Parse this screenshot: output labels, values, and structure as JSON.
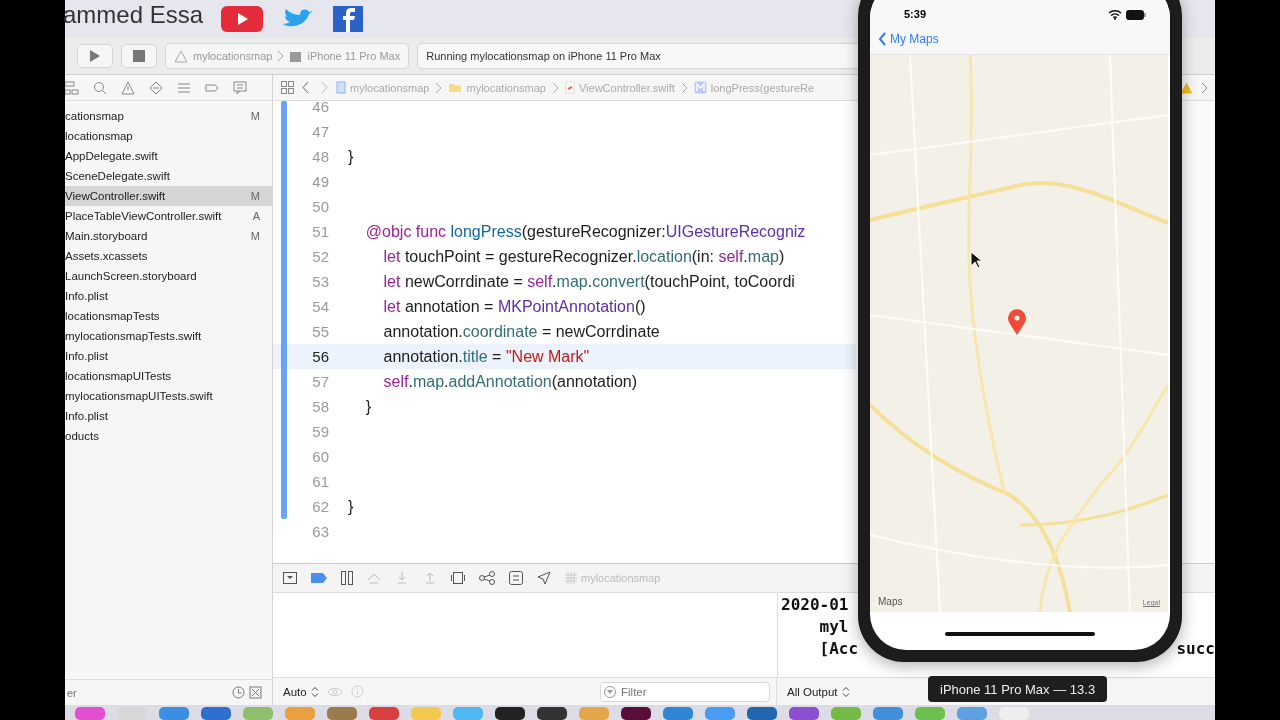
{
  "banner": {
    "name": "ammed Essa"
  },
  "toolbar": {
    "scheme": "mylocationsmap",
    "device": "iPhone 11 Pro Max",
    "status": "Running mylocationsmap on iPhone 11 Pro Max"
  },
  "navigator": {
    "items": [
      {
        "name": "cationsmap",
        "badge": "M",
        "selected": false
      },
      {
        "name": "locationsmap",
        "selected": false
      },
      {
        "name": "AppDelegate.swift",
        "selected": false
      },
      {
        "name": "SceneDelegate.swift",
        "selected": false
      },
      {
        "name": "ViewController.swift",
        "badge": "M",
        "selected": true
      },
      {
        "name": "PlaceTableViewController.swift",
        "badge": "A",
        "selected": false
      },
      {
        "name": "Main.storyboard",
        "badge": "M",
        "selected": false
      },
      {
        "name": "Assets.xcassets",
        "selected": false
      },
      {
        "name": "LaunchScreen.storyboard",
        "selected": false
      },
      {
        "name": "Info.plist",
        "selected": false
      },
      {
        "name": "locationsmapTests",
        "selected": false
      },
      {
        "name": "mylocationsmapTests.swift",
        "selected": false
      },
      {
        "name": "Info.plist",
        "selected": false
      },
      {
        "name": "locationsmapUITests",
        "selected": false
      },
      {
        "name": "mylocationsmapUITests.swift",
        "selected": false
      },
      {
        "name": "Info.plist",
        "selected": false
      },
      {
        "name": "oducts",
        "selected": false
      }
    ],
    "filter_placeholder": "er"
  },
  "jump_bar": {
    "path": [
      {
        "kind": "project",
        "label": "mylocationsmap"
      },
      {
        "kind": "folder",
        "label": "mylocationsmap"
      },
      {
        "kind": "swift",
        "label": "ViewController.swift"
      },
      {
        "kind": "method",
        "label": "longPress(gestureRe"
      }
    ]
  },
  "editor": {
    "lines": [
      {
        "number": "46",
        "current": false
      },
      {
        "number": "47",
        "current": false
      },
      {
        "number": "48",
        "current": false,
        "tokens": [
          {
            "kind": "plain",
            "text": "}"
          }
        ]
      },
      {
        "number": "49",
        "current": false
      },
      {
        "number": "50",
        "current": false
      },
      {
        "number": "51",
        "current": false,
        "tokens": [
          {
            "kind": "keyword",
            "text": "    @objc func "
          },
          {
            "kind": "decl",
            "text": "longPress"
          },
          {
            "kind": "plain",
            "text": "(gestureRecognizer:"
          },
          {
            "kind": "type",
            "text": "UIGestureRecogniz"
          }
        ]
      },
      {
        "number": "52",
        "current": false,
        "tokens": [
          {
            "kind": "keyword",
            "text": "        let"
          },
          {
            "kind": "plain",
            "text": " touchPoint = gestureRecognizer."
          },
          {
            "kind": "call",
            "text": "location"
          },
          {
            "kind": "plain",
            "text": "(in: "
          },
          {
            "kind": "keyword",
            "text": "self"
          },
          {
            "kind": "plain",
            "text": "."
          },
          {
            "kind": "call",
            "text": "map"
          },
          {
            "kind": "plain",
            "text": ")"
          }
        ]
      },
      {
        "number": "53",
        "current": false,
        "tokens": [
          {
            "kind": "keyword",
            "text": "        let"
          },
          {
            "kind": "plain",
            "text": " newCorrdinate = "
          },
          {
            "kind": "keyword",
            "text": "self"
          },
          {
            "kind": "plain",
            "text": "."
          },
          {
            "kind": "call",
            "text": "map"
          },
          {
            "kind": "plain",
            "text": "."
          },
          {
            "kind": "call",
            "text": "convert"
          },
          {
            "kind": "plain",
            "text": "(touchPoint, toCoordi"
          }
        ]
      },
      {
        "number": "54",
        "current": false,
        "tokens": [
          {
            "kind": "keyword",
            "text": "        let"
          },
          {
            "kind": "plain",
            "text": " annotation = "
          },
          {
            "kind": "type",
            "text": "MKPointAnnotation"
          },
          {
            "kind": "plain",
            "text": "()"
          }
        ]
      },
      {
        "number": "55",
        "current": false,
        "tokens": [
          {
            "kind": "plain",
            "text": "        annotation."
          },
          {
            "kind": "call",
            "text": "coordinate"
          },
          {
            "kind": "plain",
            "text": " = newCorrdinate"
          }
        ]
      },
      {
        "number": "56",
        "current": true,
        "tokens": [
          {
            "kind": "plain",
            "text": "        annotation."
          },
          {
            "kind": "call",
            "text": "title"
          },
          {
            "kind": "plain",
            "text": " = "
          },
          {
            "kind": "string",
            "text": "\"New Mark\""
          }
        ]
      },
      {
        "number": "57",
        "current": false,
        "tokens": [
          {
            "kind": "keyword",
            "text": "        self"
          },
          {
            "kind": "plain",
            "text": "."
          },
          {
            "kind": "call",
            "text": "map"
          },
          {
            "kind": "plain",
            "text": "."
          },
          {
            "kind": "call",
            "text": "addAnnotation"
          },
          {
            "kind": "plain",
            "text": "(annotation)"
          }
        ]
      },
      {
        "number": "58",
        "current": false,
        "tokens": [
          {
            "kind": "plain",
            "text": "    }"
          }
        ]
      },
      {
        "number": "59",
        "current": false
      },
      {
        "number": "60",
        "current": false
      },
      {
        "number": "61",
        "current": false
      },
      {
        "number": "62",
        "current": false,
        "tokens": [
          {
            "kind": "plain",
            "text": "}"
          }
        ]
      },
      {
        "number": "63",
        "current": false
      }
    ]
  },
  "debug_bar": {
    "target": "mylocationsmap"
  },
  "variables": {
    "mode": "Auto"
  },
  "console": {
    "lines": [
      {
        "parts": [
          "2020-01"
        ]
      },
      {
        "parts": [
          "    myl"
        ]
      },
      {
        "parts": [
          "    [Acc",
          "succ"
        ]
      }
    ],
    "filter_placeholder": "Filter",
    "output": "All Output"
  },
  "simulator": {
    "time": "5:39",
    "back": "My Maps",
    "map_label": "Maps",
    "legal": "Legal",
    "tooltip": "iPhone 11 Pro Max — 13.3"
  }
}
